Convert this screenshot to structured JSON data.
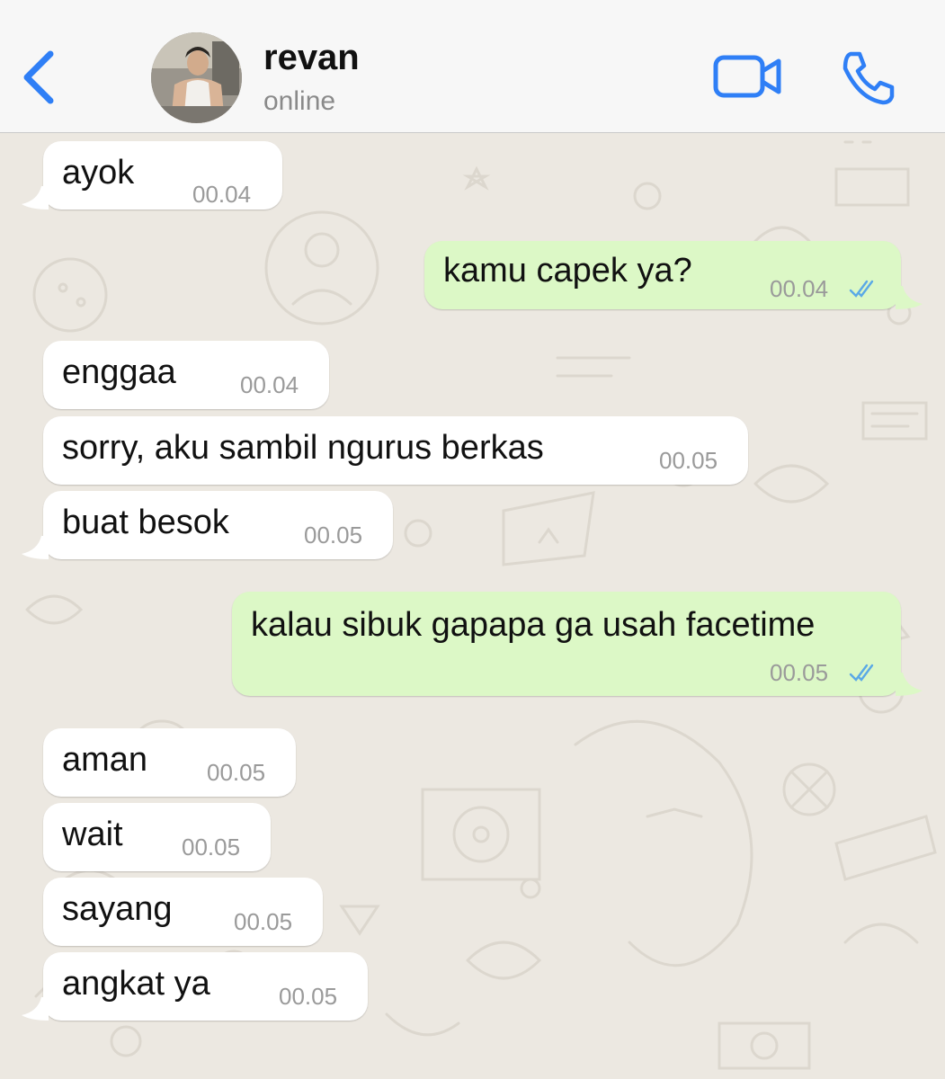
{
  "header": {
    "contact_name": "revan",
    "status": "online"
  },
  "icons": {
    "back": "chevron-left-icon",
    "video": "video-camera-icon",
    "call": "phone-icon",
    "read": "double-check-icon"
  },
  "colors": {
    "accent": "#2f7ff6",
    "outgoing_bubble": "#dcf8c6",
    "incoming_bubble": "#ffffff",
    "read_ticks": "#5aa9e6"
  },
  "messages": [
    {
      "direction": "in",
      "text": "ayok",
      "time": "00.04"
    },
    {
      "direction": "out",
      "text": "kamu capek ya?",
      "time": "00.04",
      "read": true
    },
    {
      "direction": "in",
      "text": "enggaa",
      "time": "00.04"
    },
    {
      "direction": "in",
      "text": "sorry, aku sambil ngurus berkas",
      "time": "00.05"
    },
    {
      "direction": "in",
      "text": "buat besok",
      "time": "00.05"
    },
    {
      "direction": "out",
      "text": "kalau sibuk gapapa ga usah facetime",
      "time": "00.05",
      "read": true
    },
    {
      "direction": "in",
      "text": "aman",
      "time": "00.05"
    },
    {
      "direction": "in",
      "text": "wait",
      "time": "00.05"
    },
    {
      "direction": "in",
      "text": "sayang",
      "time": "00.05"
    },
    {
      "direction": "in",
      "text": "angkat ya",
      "time": "00.05"
    }
  ]
}
